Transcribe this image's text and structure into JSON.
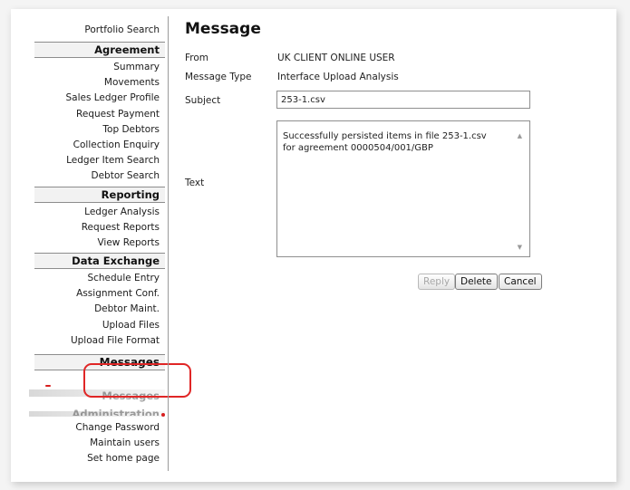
{
  "sidebar": {
    "top_link": "Portfolio Search",
    "sections": [
      {
        "heading": "Agreement",
        "items": [
          "Summary",
          "Movements",
          "Sales Ledger Profile",
          "Request Payment",
          "Top Debtors",
          "Collection Enquiry",
          "Ledger Item Search",
          "Debtor Search"
        ]
      },
      {
        "heading": "Reporting",
        "items": [
          "Ledger Analysis",
          "Request Reports",
          "View Reports"
        ]
      },
      {
        "heading": "Data Exchange",
        "items": [
          "Schedule Entry",
          "Assignment Conf.",
          "Debtor Maint.",
          "Upload Files",
          "Upload File Format"
        ]
      }
    ],
    "messages_heading": "Messages",
    "messages_ghost": "Messages",
    "admin_ghost": "Administration",
    "admin_items": [
      "Change Password",
      "Maintain users",
      "Set home page"
    ]
  },
  "message": {
    "title": "Message",
    "from_label": "From",
    "from_value": "UK CLIENT ONLINE USER",
    "type_label": "Message Type",
    "type_value": "Interface Upload Analysis",
    "subject_label": "Subject",
    "subject_value": "253-1.csv",
    "text_label": "Text",
    "text_value": "Successfully persisted items in file 253-1.csv for agreement 0000504/001/GBP",
    "reply_label": "Reply",
    "delete_label": "Delete",
    "cancel_label": "Cancel"
  },
  "colors": {
    "highlight_ring": "#e02626"
  }
}
